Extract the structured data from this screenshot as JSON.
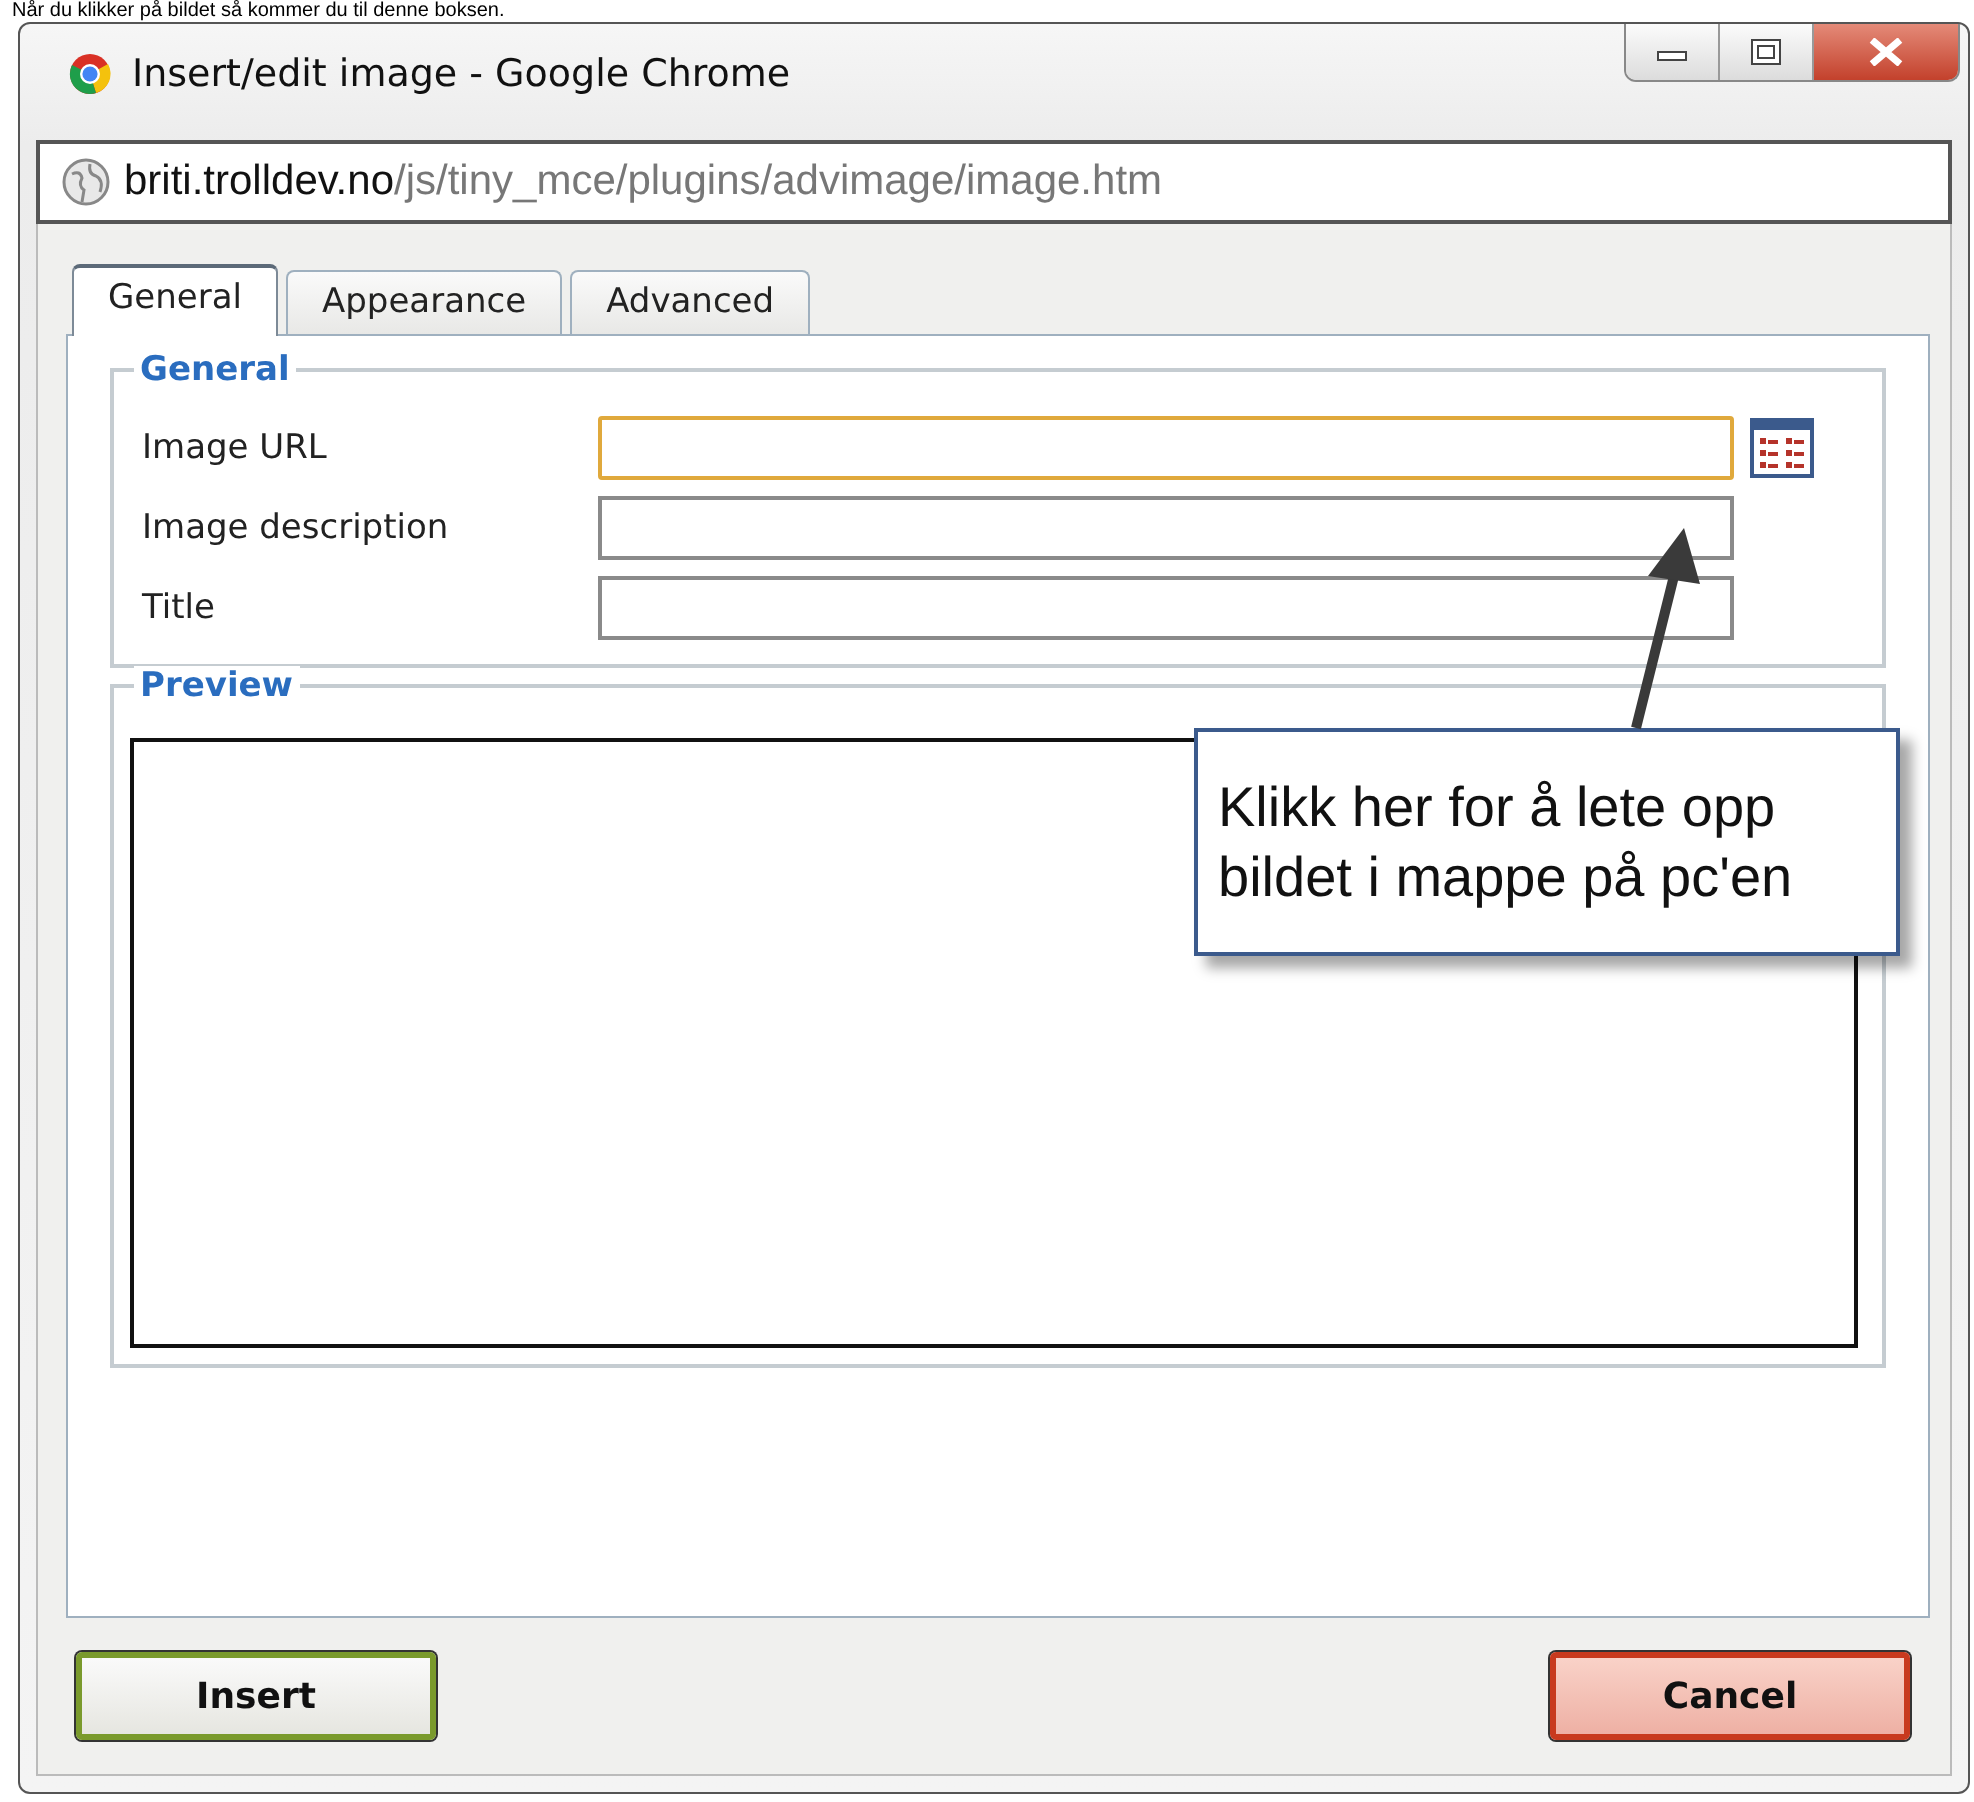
{
  "caption": "Når du klikker på bildet så kommer du til denne boksen.",
  "window": {
    "title": "Insert/edit image - Google Chrome"
  },
  "address_bar": {
    "host": "briti.trolldev.no",
    "path": "/js/tiny_mce/plugins/advimage/image.htm"
  },
  "tabs": [
    {
      "label": "General",
      "selected": true
    },
    {
      "label": "Appearance",
      "selected": false
    },
    {
      "label": "Advanced",
      "selected": false
    }
  ],
  "general_section": {
    "legend": "General",
    "fields": [
      {
        "label": "Image URL",
        "focused": true,
        "browse": true
      },
      {
        "label": "Image description",
        "focused": false,
        "browse": false
      },
      {
        "label": "Title",
        "focused": false,
        "browse": false
      }
    ]
  },
  "preview_section": {
    "legend": "Preview"
  },
  "callout": {
    "text": "Klikk her for å lete opp bildet i mappe på pc'en"
  },
  "buttons": [
    {
      "label": "Insert",
      "kind": "insert"
    },
    {
      "label": "Cancel",
      "kind": "cancel"
    }
  ]
}
